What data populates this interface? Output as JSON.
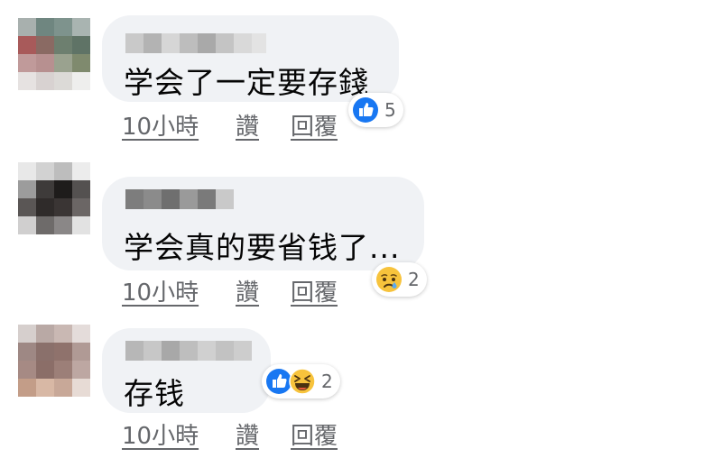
{
  "comments": [
    {
      "text": "学会了一定要存錢",
      "time": "10小時",
      "like_label": "讚",
      "reply_label": "回覆",
      "reactions": [
        "like-icon"
      ],
      "reaction_count": "5"
    },
    {
      "text": "学会真的要省钱了...",
      "time": "10小時",
      "like_label": "讚",
      "reply_label": "回覆",
      "reactions": [
        "sad-icon"
      ],
      "reaction_count": "2"
    },
    {
      "text": "存钱",
      "time": "10小時",
      "like_label": "讚",
      "reply_label": "回覆",
      "reactions": [
        "like-icon",
        "haha-icon"
      ],
      "reaction_count": "2"
    }
  ],
  "colors": {
    "bubble": "#f0f2f5",
    "text": "#050505",
    "meta": "#65676b",
    "like_blue": "#1877f2",
    "emoji_yellow": "#f7c33c"
  }
}
